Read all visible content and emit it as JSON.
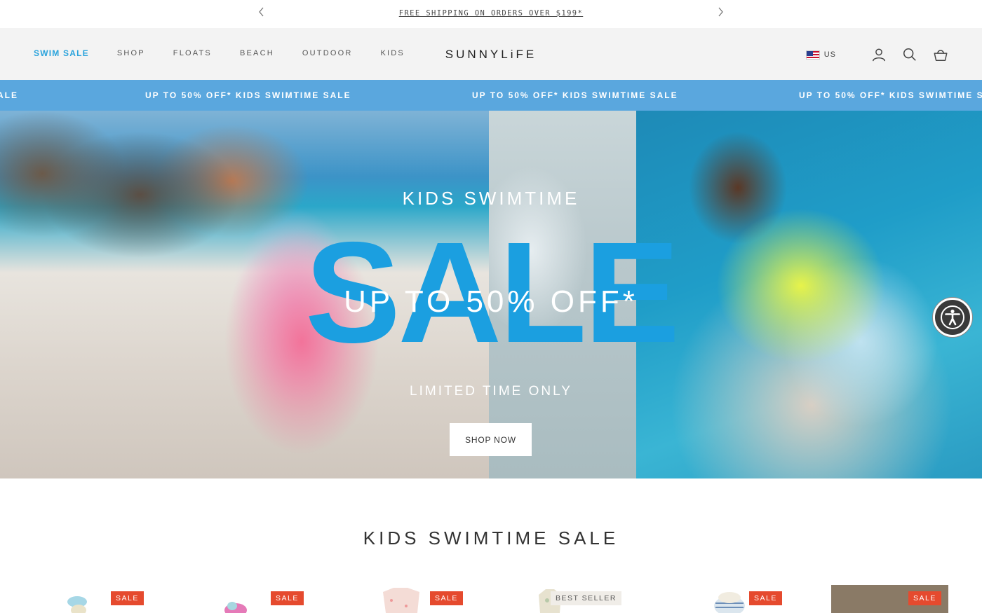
{
  "announcement": {
    "message": "FREE SHIPPING ON ORDERS OVER $199*",
    "prev_icon": "chevron-left-icon",
    "next_icon": "chevron-right-icon"
  },
  "header": {
    "logo": "SUNNYLiFE",
    "nav": [
      {
        "label": "SWIM SALE"
      },
      {
        "label": "SHOP"
      },
      {
        "label": "FLOATS"
      },
      {
        "label": "BEACH"
      },
      {
        "label": "OUTDOOR"
      },
      {
        "label": "KIDS"
      }
    ],
    "region": "US",
    "icons": [
      "account-icon",
      "search-icon",
      "cart-icon"
    ],
    "accent_color": "#2aa3dc"
  },
  "marquee": {
    "items": [
      "ALE",
      "UP TO 50% OFF* KIDS SWIMTIME SALE",
      "UP TO 50% OFF* KIDS SWIMTIME SALE",
      "UP TO 50% OFF* KIDS SWIMTIME SA"
    ],
    "background": "#5aa7de"
  },
  "hero": {
    "kicker": "KIDS SWIMTIME",
    "sale_word": "SALE",
    "offer": "UP TO 50% OFF*",
    "limited": "LIMITED TIME ONLY",
    "cta": "SHOP NOW",
    "sale_color": "#1b9fe0"
  },
  "section": {
    "title": "KIDS SWIMTIME SALE"
  },
  "products": [
    {
      "badge": "SALE"
    },
    {
      "badge": "SALE"
    },
    {
      "badge": "SALE"
    },
    {
      "badge": "BEST SELLER"
    },
    {
      "badge": "SALE"
    },
    {
      "badge": "SALE"
    }
  ],
  "accessibility": {
    "icon": "accessibility-icon"
  }
}
